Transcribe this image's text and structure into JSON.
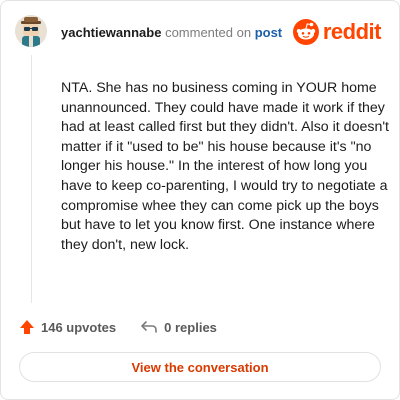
{
  "comment": {
    "username": "yachtiewannabe",
    "action_text": "commented on",
    "target_text": "post",
    "body": "NTA. She has no business coming in YOUR home unannounced. They could have made it work if they had at least called first but they didn't. Also it doesn't matter if it \"used to be\" his house because it's \"no longer his house.\" In the interest of how long you have to keep co-parenting, I would try to negotiate a compromise whee they can come pick up the boys but have to let you know first. One instance where they don't, new lock."
  },
  "brand": {
    "name": "reddit",
    "color": "#ff4500"
  },
  "actions": {
    "upvotes_label": "146 upvotes",
    "replies_label": "0 replies",
    "upvote_icon": "upvote-arrow-icon",
    "reply_icon": "reply-arrow-icon"
  },
  "cta": {
    "label": "View the conversation",
    "color": "#d93a00"
  },
  "colors": {
    "upvote": "#ff4500",
    "link": "#1c5fa8",
    "muted": "#7c7c7c"
  }
}
